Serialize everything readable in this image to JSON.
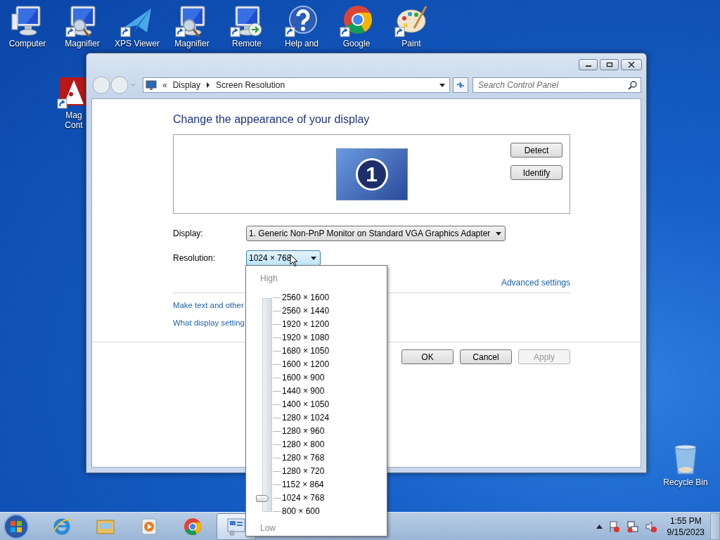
{
  "desktop_icons": [
    {
      "label": "Computer",
      "kind": "computer",
      "shortcut": false
    },
    {
      "label": "Magnifier",
      "kind": "magnifier",
      "shortcut": true
    },
    {
      "label": "XPS Viewer",
      "kind": "xps",
      "shortcut": true
    },
    {
      "label": "Magnifier",
      "kind": "magnifier",
      "shortcut": true
    },
    {
      "label": "Remote",
      "kind": "remote",
      "shortcut": true
    },
    {
      "label": "Help and",
      "kind": "help",
      "shortcut": true
    },
    {
      "label": "Google",
      "kind": "chrome",
      "shortcut": true
    },
    {
      "label": "Paint",
      "kind": "paint",
      "shortcut": true
    }
  ],
  "side_icon": {
    "label": "Mag Cont",
    "kind": "hat",
    "shortcut": true
  },
  "recycle_bin": {
    "label": "Recycle Bin"
  },
  "window": {
    "address_bar": {
      "separator": "«",
      "crumbs": [
        "Display",
        "Screen Resolution"
      ]
    },
    "search": {
      "placeholder": "Search Control Panel"
    },
    "heading": "Change the appearance of your display",
    "monitor_number": "1",
    "side_buttons": [
      "Detect",
      "Identify"
    ],
    "display": {
      "label": "Display:",
      "value": "1. Generic Non-PnP Monitor on Standard VGA Graphics Adapter"
    },
    "resolution": {
      "label": "Resolution:",
      "value": "1024 × 768",
      "expanded": true
    },
    "advanced_link": "Advanced settings",
    "links": [
      "Make text and other",
      "What display setting"
    ],
    "buttons": [
      {
        "label": "OK",
        "disabled": false
      },
      {
        "label": "Cancel",
        "disabled": false
      },
      {
        "label": "Apply",
        "disabled": true
      }
    ]
  },
  "resolution_popup": {
    "high_label": "High",
    "low_label": "Low",
    "level": 0.0625,
    "options": [
      "2560 × 1600",
      "2560 × 1440",
      "1920 × 1200",
      "1920 × 1080",
      "1680 × 1050",
      "1600 × 1200",
      "1600 × 900",
      "1440 × 900",
      "1400 × 1050",
      "1280 × 1024",
      "1280 × 960",
      "1280 × 800",
      "1280 × 768",
      "1280 × 720",
      "1152 × 864",
      "1024 × 768",
      "800 × 600"
    ]
  },
  "taskbar": {
    "apps": [
      {
        "kind": "ie",
        "active": false
      },
      {
        "kind": "explorer",
        "active": false
      },
      {
        "kind": "media",
        "active": false
      },
      {
        "kind": "chrome",
        "active": false
      },
      {
        "kind": "control",
        "active": true
      }
    ],
    "clock": {
      "time": "1:55 PM",
      "date": "9/15/2023"
    }
  }
}
